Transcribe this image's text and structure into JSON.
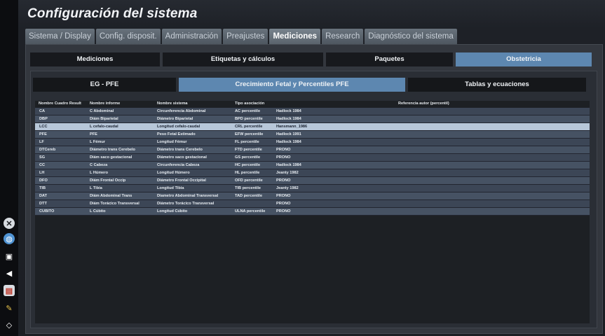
{
  "title": "Configuración del sistema",
  "main_tabs": [
    "Sistema / Display",
    "Config. disposit.",
    "Administración",
    "Preajustes",
    "Mediciones",
    "Research",
    "Diagnóstico del sistema"
  ],
  "sub_tabs": [
    "Mediciones",
    "Etiquetas y cálculos",
    "Paquetes",
    "Obstetricia"
  ],
  "inner_tabs": [
    "EG - PFE",
    "Crecimiento Fetal y Percentiles PFE",
    "Tablas y ecuaciones"
  ],
  "table": {
    "headers": [
      "Nombre Cuadro Result",
      "Nombre informe",
      "Nombre sistema",
      "Tipo asociación",
      "Referencia autor (percentil)"
    ],
    "rows": [
      [
        "CA",
        "C Abdominal",
        "Circunferencia Abdominal",
        "AC percentile",
        "Hadlock 1984"
      ],
      [
        "DBP",
        "Diám Biparietal",
        "Diámetro Biparietal",
        "BPD percentile",
        "Hadlock 1984"
      ],
      [
        "LCC",
        "L cefalo-caudal",
        "Longitud cefalo-caudal",
        "CRL percentile",
        "Hansmann_1986"
      ],
      [
        "PFE",
        "PFE",
        "Peso Fetal Estimado",
        "EFW percentile",
        "Hadlock 1991"
      ],
      [
        "LF",
        "L Fémur",
        "Longitud Fémur",
        "FL percentile",
        "Hadlock 1984"
      ],
      [
        "DTCereb",
        "Diámetro trans Cerebelo",
        "Diámetro trans Cerebelo",
        "FTD percentile",
        "PRONO"
      ],
      [
        "SG",
        "Diám saco gestacional",
        "Diámetro saco gestacional",
        "GS percentile",
        "PRONO"
      ],
      [
        "CC",
        "C Cabeza",
        "Circunferencia Cabeza",
        "HC percentile",
        "Hadlock 1984"
      ],
      [
        "LH",
        "L Húmero",
        "Longitud Húmero",
        "HL percentile",
        "Jeanty 1982"
      ],
      [
        "DFO",
        "Diám Frontal Occip",
        "Diámetro Frontal Occipital",
        "OFD percentile",
        "PRONO"
      ],
      [
        "TIB",
        "L Tibia",
        "Longitud Tibia",
        "TIB percentile",
        "Jeanty 1982"
      ],
      [
        "DAT",
        "Diám Abdominal Trans",
        "Diametro Abdominal Transversal",
        "TAD percentile",
        "PRONO"
      ],
      [
        "DTT",
        "Diám Torácico Transversal",
        "Diámetro Torácico Transversal",
        "",
        "PRONO"
      ],
      [
        "CÚBITO",
        "L Cúbito",
        "Longitud Cúbito",
        "ULNA percentile",
        "PRONO"
      ]
    ]
  },
  "sidebar_icons": [
    "close-icon",
    "globe-icon",
    "print-icon",
    "volume-icon",
    "report-icon",
    "brush-icon",
    "network-icon"
  ],
  "colors": {
    "active_tab": "#5d87b0",
    "selected_row": "#b7c7d9",
    "row": "#3c4656"
  }
}
